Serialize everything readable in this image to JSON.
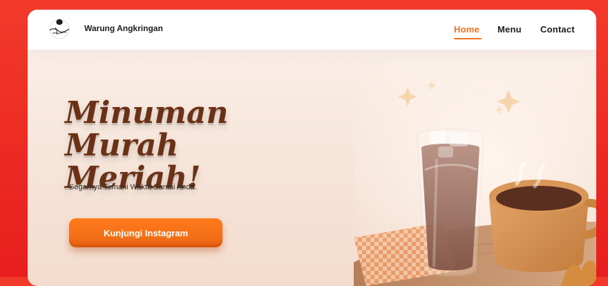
{
  "nav": {
    "brand": "Warung Angkringan",
    "items": [
      "Home",
      "Menu",
      "Contact"
    ],
    "active": "Home"
  },
  "hero": {
    "title_line1": "Minuman",
    "title_line2": "Murah Meriah!",
    "subtitle": "Segarnya Temani Waktu Santai Anda.",
    "cta": "Kunjungi Instagram"
  },
  "colors": {
    "background": "#e81e1e",
    "accent": "#f2701b",
    "title": "#6b3116"
  },
  "icons": {
    "logo": "warung-angkringan-logo",
    "illustration": "iced-chocolate-and-coffee-cup-illustration"
  }
}
